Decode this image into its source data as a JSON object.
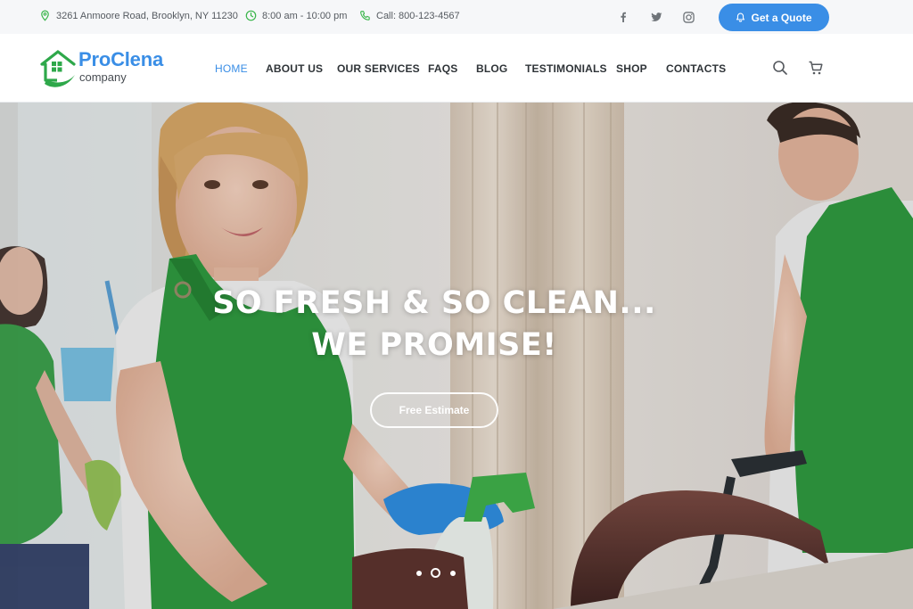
{
  "topbar": {
    "address": "3261 Anmoore Road, Brooklyn, NY 11230",
    "hours": "8:00 am - 10:00 pm",
    "phone": "Call: 800-123-4567",
    "social": [
      "facebook-icon",
      "twitter-icon",
      "instagram-icon"
    ],
    "quote_button": "Get a Quote"
  },
  "logo": {
    "name": "ProClena",
    "sub": "company"
  },
  "nav": {
    "items": [
      "HOME",
      "ABOUT US",
      "OUR SERVICES",
      "FAQS",
      "BLOG",
      "TESTIMONIALS",
      "SHOP",
      "CONTACTS"
    ],
    "active": "HOME"
  },
  "hero": {
    "title_line1": "SO FRESH & SO CLEAN...",
    "title_line2": "WE PROMISE!",
    "cta": "Free Estimate",
    "slides_count": 3,
    "active_slide": 2
  },
  "colors": {
    "accent": "#3a8ee6",
    "brand_green": "#2ea84a",
    "apron_green": "#2f9a3f"
  }
}
